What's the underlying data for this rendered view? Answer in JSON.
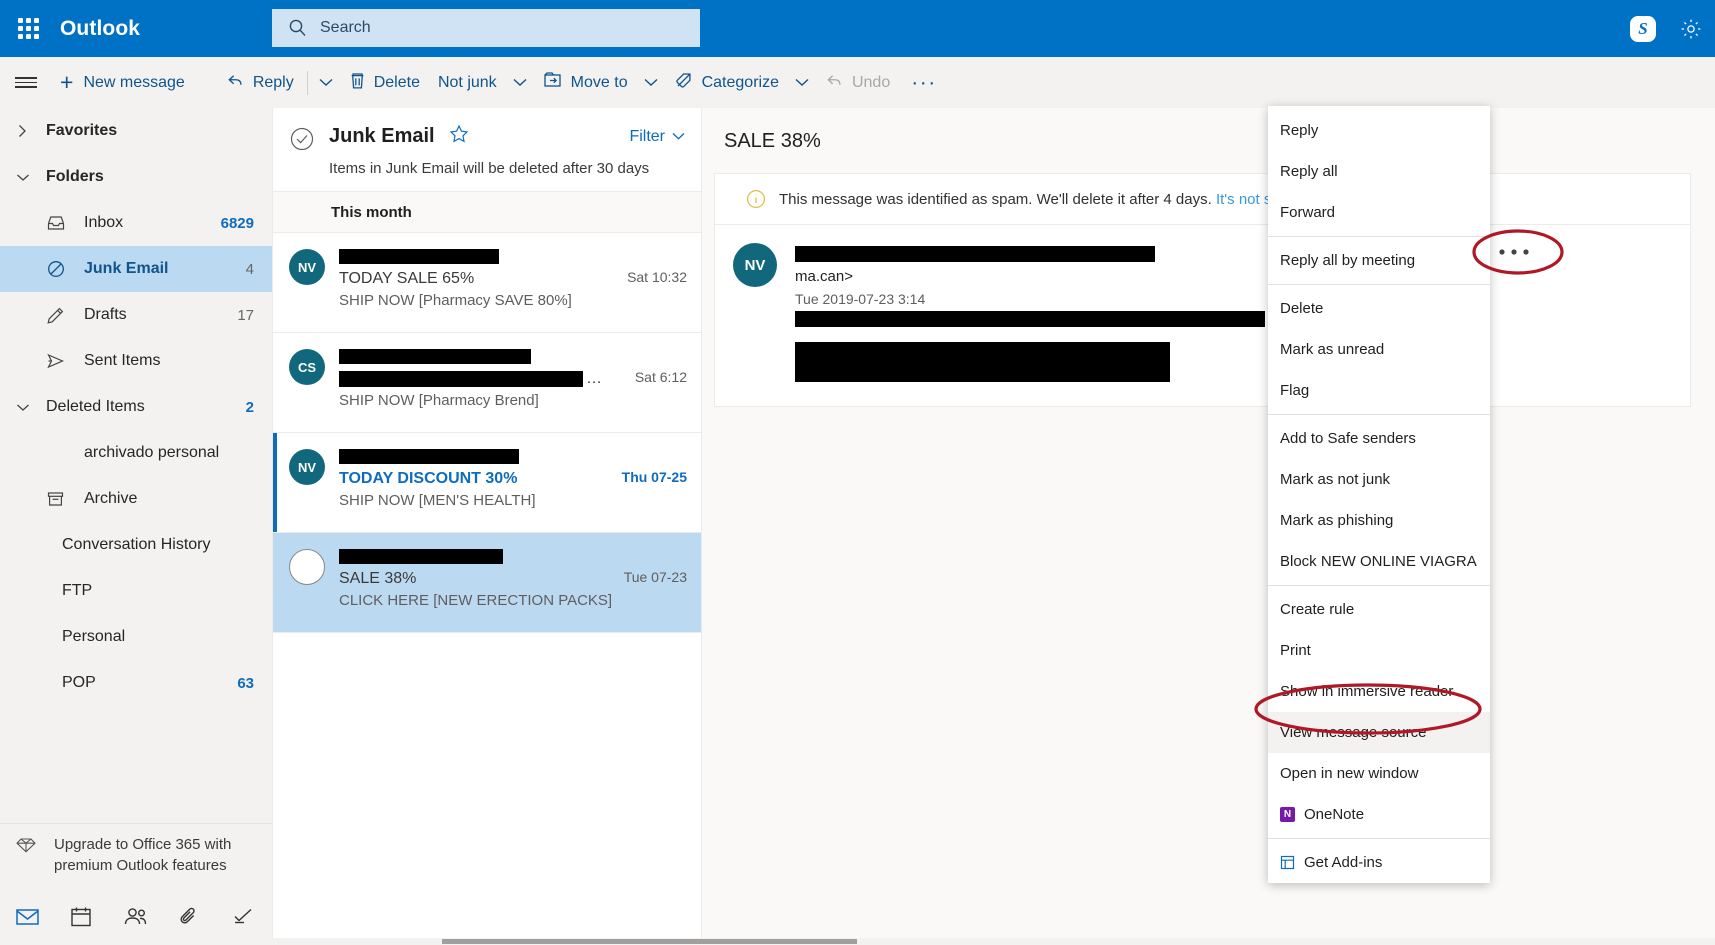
{
  "topbar": {
    "brand": "Outlook",
    "app_launcher_icon": "waffle-icon",
    "search_placeholder": "Search",
    "search_value": "",
    "search_icon": "search-icon",
    "skype_label": "S",
    "skype_icon": "skype-icon",
    "settings_icon": "gear-icon",
    "bg_color": "#0072c6",
    "search_bg": "#cfe3f5"
  },
  "commandbar": {
    "menu_icon": "hamburger-icon",
    "new_message": "New message",
    "reply": "Reply",
    "delete": "Delete",
    "not_junk": "Not junk",
    "move_to": "Move to",
    "categorize": "Categorize",
    "undo": "Undo",
    "more": "···",
    "accent": "#0f548c",
    "bg": "#f3f2f1"
  },
  "sidebar": {
    "favorites": "Favorites",
    "folders": "Folders",
    "items": [
      {
        "label": "Inbox",
        "count": "6829",
        "icon": "inbox-icon",
        "selected": false,
        "count_style": "blue"
      },
      {
        "label": "Junk Email",
        "count": "4",
        "icon": "block-icon",
        "selected": true,
        "count_style": "plain"
      },
      {
        "label": "Drafts",
        "count": "17",
        "icon": "pencil-icon",
        "selected": false,
        "count_style": "plain"
      },
      {
        "label": "Sent Items",
        "count": "",
        "icon": "send-icon",
        "selected": false,
        "count_style": "plain"
      },
      {
        "label": "Deleted Items",
        "count": "2",
        "icon": "chevron-down-icon",
        "selected": false,
        "count_style": "blue"
      },
      {
        "label": "archivado personal",
        "count": "",
        "icon": "none",
        "selected": false,
        "count_style": "plain"
      },
      {
        "label": "Archive",
        "count": "",
        "icon": "archive-icon",
        "selected": false,
        "count_style": "plain"
      },
      {
        "label": "Conversation History",
        "count": "",
        "icon": "none",
        "selected": false,
        "count_style": "plain"
      },
      {
        "label": "FTP",
        "count": "",
        "icon": "none",
        "selected": false,
        "count_style": "plain"
      },
      {
        "label": "Personal",
        "count": "",
        "icon": "none",
        "selected": false,
        "count_style": "plain"
      },
      {
        "label": "POP",
        "count": "63",
        "icon": "none",
        "selected": false,
        "count_style": "blue"
      }
    ],
    "upgrade_text": "Upgrade to Office 365 with premium Outlook features",
    "upgrade_icon": "diamond-icon",
    "bottom_nav": [
      {
        "name": "mail-icon"
      },
      {
        "name": "calendar-icon"
      },
      {
        "name": "people-icon"
      },
      {
        "name": "attachment-icon"
      },
      {
        "name": "tasks-icon"
      }
    ]
  },
  "list": {
    "title": "Junk Email",
    "star_icon": "star-icon",
    "select_all_icon": "select-all-circle-icon",
    "filter_label": "Filter",
    "retention_notice": "Items in Junk Email will be deleted after 30 days",
    "group_header": "This month",
    "messages": [
      {
        "avatar": "NV",
        "avatar_style": "filled",
        "sender_redacted": true,
        "sender_redact_width": 160,
        "subject": "TODAY SALE 65%",
        "subject_style": "normal",
        "preview": "SHIP NOW [Pharmacy SAVE 80%]",
        "preview_redacted": false,
        "date": "Sat 10:32",
        "unread": false,
        "selected": false
      },
      {
        "avatar": "CS",
        "avatar_style": "filled",
        "sender_redacted": true,
        "sender_redact_width": 192,
        "subject": "",
        "subject_style": "normal",
        "subject_redact_width": 244,
        "subject_redacted": true,
        "preview": "SHIP NOW [Pharmacy Brend]",
        "preview_redacted": false,
        "date": "Sat 6:12",
        "unread": false,
        "selected": false
      },
      {
        "avatar": "NV",
        "avatar_style": "filled",
        "sender_redacted": true,
        "sender_redact_width": 180,
        "subject": "TODAY DISCOUNT 30%",
        "subject_style": "blue",
        "preview": "SHIP NOW [MEN'S HEALTH]",
        "preview_redacted": false,
        "date": "Thu 07-25",
        "date_style": "blue",
        "unread": true,
        "selected": false
      },
      {
        "avatar": "",
        "avatar_style": "hollow",
        "sender_redacted": true,
        "sender_redact_width": 164,
        "subject": "SALE 38%",
        "subject_style": "normal",
        "preview": "CLICK HERE [NEW ERECTION PACKS]",
        "preview_redacted": false,
        "date": "Tue 07-23",
        "unread": false,
        "selected": true
      }
    ]
  },
  "reading_pane": {
    "subject": "SALE 38%",
    "spam_icon": "info-icon",
    "spam_notice": "This message was identified as spam. We'll delete it after 4 days.",
    "spam_link": "It's not spam",
    "avatar": "NV",
    "from_line_redacted": true,
    "from_line_tail": "ma.can>",
    "date": "Tue 2019-07-23 3:14",
    "recipients_redacted": true
  },
  "context_menu": {
    "items": [
      {
        "label": "Reply",
        "icon": "",
        "separator_after": false,
        "highlighted": false
      },
      {
        "label": "Reply all",
        "icon": "",
        "separator_after": false,
        "highlighted": false
      },
      {
        "label": "Forward",
        "icon": "",
        "separator_after": true,
        "highlighted": false
      },
      {
        "label": "Reply all by meeting",
        "icon": "",
        "separator_after": true,
        "highlighted": false
      },
      {
        "label": "Delete",
        "icon": "",
        "separator_after": false,
        "highlighted": false
      },
      {
        "label": "Mark as unread",
        "icon": "",
        "separator_after": false,
        "highlighted": false
      },
      {
        "label": "Flag",
        "icon": "",
        "separator_after": true,
        "highlighted": false
      },
      {
        "label": "Add to Safe senders",
        "icon": "",
        "separator_after": false,
        "highlighted": false
      },
      {
        "label": "Mark as not junk",
        "icon": "",
        "separator_after": false,
        "highlighted": false
      },
      {
        "label": "Mark as phishing",
        "icon": "",
        "separator_after": false,
        "highlighted": false
      },
      {
        "label": "Block NEW ONLINE VIAGRA",
        "icon": "",
        "separator_after": true,
        "highlighted": false
      },
      {
        "label": "Create rule",
        "icon": "",
        "separator_after": false,
        "highlighted": false
      },
      {
        "label": "Print",
        "icon": "",
        "separator_after": false,
        "highlighted": false
      },
      {
        "label": "Show in immersive reader",
        "icon": "",
        "separator_after": false,
        "highlighted": false
      },
      {
        "label": "View message source",
        "icon": "",
        "separator_after": false,
        "highlighted": true
      },
      {
        "label": "Open in new window",
        "icon": "",
        "separator_after": false,
        "highlighted": false
      },
      {
        "label": "OneNote",
        "icon": "onenote-icon",
        "separator_after": true,
        "highlighted": false
      },
      {
        "label": "Get Add-ins",
        "icon": "addins-icon",
        "separator_after": false,
        "highlighted": false
      }
    ]
  },
  "annotations": {
    "ellipse_color": "#b01826",
    "ellipse_more_button": "more-options-ellipsis",
    "ellipse_menu_item": "View message source"
  }
}
